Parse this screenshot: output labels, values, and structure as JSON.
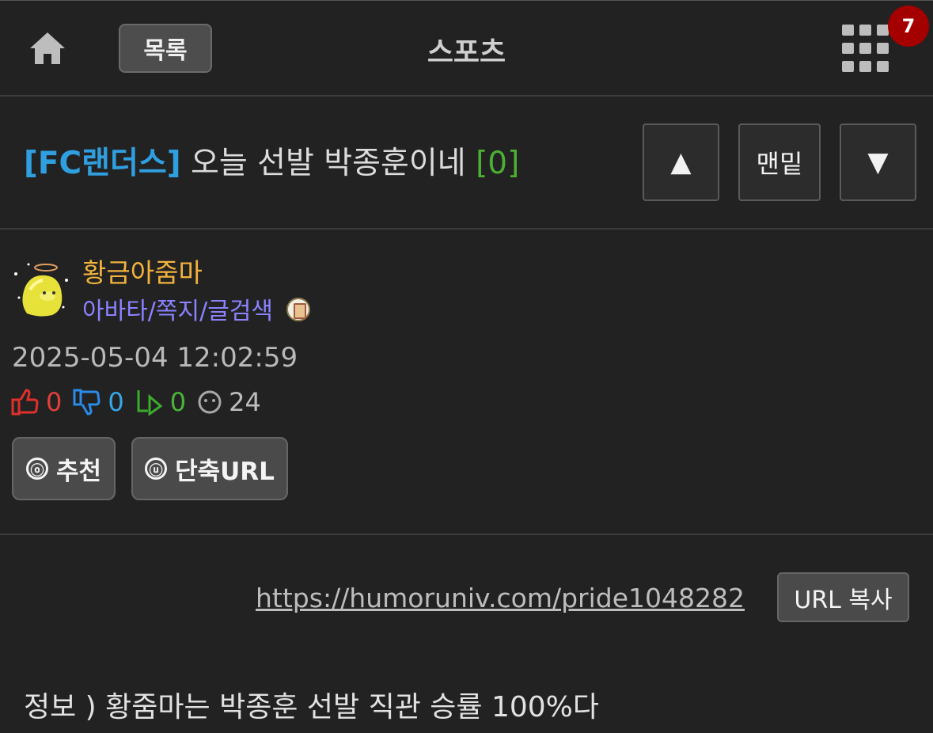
{
  "header": {
    "home_icon": "home-icon",
    "list_label": "목록",
    "board_name": "스포츠",
    "menu_icon": "grid-icon",
    "notification_count": "7"
  },
  "post": {
    "category": "[FC랜더스]",
    "title": "오늘 선발 박종훈이네",
    "comment_count": "[0]",
    "nav": {
      "up_label": "▲",
      "bottom_label": "맨밑",
      "down_label": "▼"
    }
  },
  "author": {
    "nickname": "황금아줌마",
    "links": "아바타/쪽지/글검색",
    "medal_icon": "medal-icon"
  },
  "meta": {
    "date": "2025-05-04 12:02:59",
    "upvotes": "0",
    "downvotes": "0",
    "replies": "0",
    "views": "24"
  },
  "actions": {
    "recommend_icon": "ⓞ",
    "recommend_label": "추천",
    "short_url_icon": "ⓤ",
    "short_url_label": "단축URL"
  },
  "url": {
    "link": "https://humoruniv.com/pride1048282",
    "copy_label": "URL 복사"
  },
  "content": {
    "body": "정보 )  황줌마는 박종훈 선발 직관 승률 100%다"
  },
  "colors": {
    "background": "#222222",
    "category": "#2f9fe0",
    "comment_count": "#4caf33",
    "nickname": "#f2b33d",
    "links": "#8a82ff",
    "badge": "#a40000"
  }
}
